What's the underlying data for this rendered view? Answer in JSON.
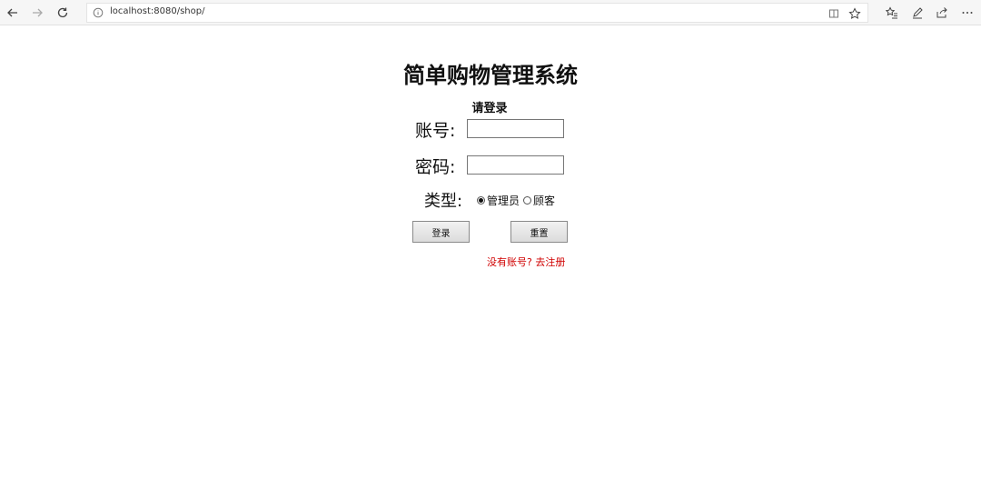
{
  "browser": {
    "url": "localhost:8080/shop/"
  },
  "page": {
    "title": "简单购物管理系统",
    "subtitle": "请登录",
    "account_label": "账号:",
    "password_label": "密码:",
    "type_label": "类型:",
    "type_options": [
      {
        "label": "管理员",
        "selected": true
      },
      {
        "label": "顾客",
        "selected": false
      }
    ],
    "login_button": "登录",
    "reset_button": "重置",
    "register_prompt": "没有账号? 去注册"
  }
}
